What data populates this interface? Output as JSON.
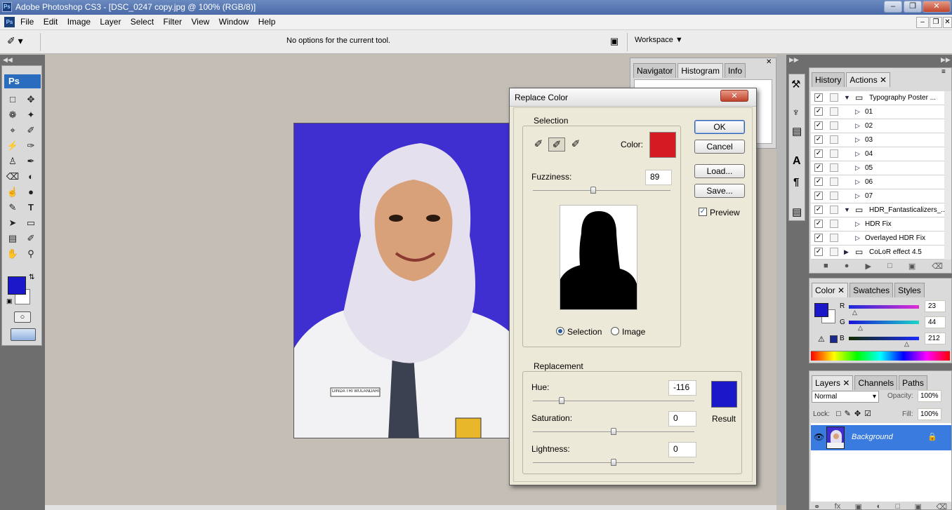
{
  "app": {
    "title": "Adobe Photoshop CS3 - [DSC_0247 copy.jpg @ 100% (RGB/8)]",
    "logo": "Ps",
    "window_buttons": [
      "minimize",
      "restore",
      "close"
    ]
  },
  "menu": [
    "File",
    "Edit",
    "Image",
    "Layer",
    "Select",
    "Filter",
    "View",
    "Window",
    "Help"
  ],
  "options_bar": {
    "message": "No options for the current tool.",
    "workspace_label": "Workspace"
  },
  "toolbox": {
    "logo": "Ps",
    "foreground_color": "#1a18c8",
    "background_color": "#ffffff"
  },
  "photo": {
    "name_tag": "DINDA TRI WULANDARI"
  },
  "nav_panel": {
    "tabs": [
      "Navigator",
      "Histogram",
      "Info"
    ]
  },
  "dialog": {
    "title": "Replace Color",
    "selection_legend": "Selection",
    "color_label": "Color:",
    "color_swatch": "#d41a22",
    "fuzziness_label": "Fuzziness:",
    "fuzziness_value": "89",
    "fuzziness_fraction": 0.44,
    "radio_selection": "Selection",
    "radio_image": "Image",
    "replacement_legend": "Replacement",
    "hue_label": "Hue:",
    "hue_value": "-116",
    "hue_fraction": 0.18,
    "saturation_label": "Saturation:",
    "saturation_value": "0",
    "saturation_fraction": 0.5,
    "lightness_label": "Lightness:",
    "lightness_value": "0",
    "lightness_fraction": 0.5,
    "result_label": "Result",
    "result_swatch": "#1a18c8",
    "ok": "OK",
    "cancel": "Cancel",
    "load": "Load...",
    "save": "Save...",
    "preview": "Preview"
  },
  "history_panel": {
    "tabs": [
      "History",
      "Actions"
    ],
    "actions": [
      {
        "label": "Typography Poster ...",
        "kind": "set",
        "open": true
      },
      {
        "label": "01",
        "kind": "action"
      },
      {
        "label": "02",
        "kind": "action"
      },
      {
        "label": "03",
        "kind": "action"
      },
      {
        "label": "04",
        "kind": "action"
      },
      {
        "label": "05",
        "kind": "action"
      },
      {
        "label": "06",
        "kind": "action"
      },
      {
        "label": "07",
        "kind": "action"
      },
      {
        "label": "HDR_Fantasticalizers_...",
        "kind": "set",
        "open": true
      },
      {
        "label": "HDR Fix",
        "kind": "action"
      },
      {
        "label": "Overlayed HDR Fix",
        "kind": "action"
      },
      {
        "label": "CoLoR effect 4.5",
        "kind": "set",
        "open": false
      }
    ]
  },
  "color_panel": {
    "tabs": [
      "Color",
      "Swatches",
      "Styles"
    ],
    "r_label": "R",
    "r_value": "23",
    "g_label": "G",
    "g_value": "44",
    "b_label": "B",
    "b_value": "212",
    "r_fraction": 0.09,
    "g_fraction": 0.17,
    "b_fraction": 0.83
  },
  "layers_panel": {
    "tabs": [
      "Layers",
      "Channels",
      "Paths"
    ],
    "blend_mode": "Normal",
    "opacity_label": "Opacity:",
    "opacity_value": "100%",
    "lock_label": "Lock:",
    "fill_label": "Fill:",
    "fill_value": "100%",
    "layer_name": "Background"
  }
}
